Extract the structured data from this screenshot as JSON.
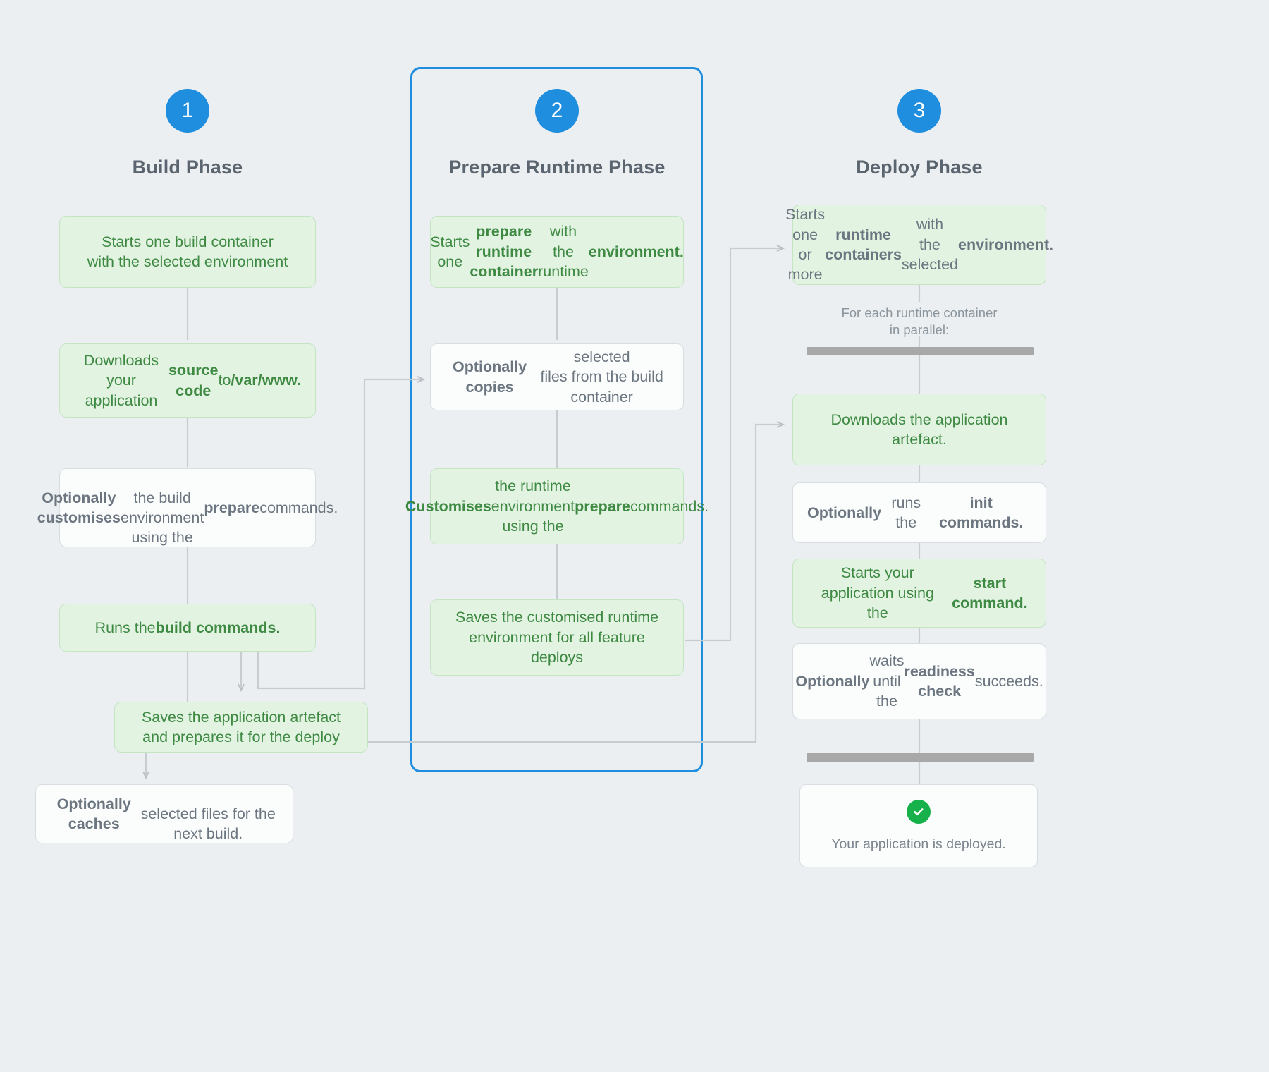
{
  "diagram": {
    "type": "flowchart",
    "background_color": "#eceff1",
    "accent_color": "#1f8ede",
    "green_box_bg": "#e2f3e2",
    "green_text_color": "#3f8a43",
    "gray_text_color": "#6b7680",
    "success_color": "#16b14b",
    "highlighted_phase": "Prepare Runtime Phase"
  },
  "columns": [
    {
      "number": "1",
      "title": "Build Phase",
      "steps": [
        {
          "id": "b1",
          "style": "green",
          "html": "Starts one build container<br>with the selected environment"
        },
        {
          "id": "b2",
          "style": "green",
          "html": "Downloads your application<br><b>source code</b> to <b>/var/www.</b>"
        },
        {
          "id": "b3",
          "style": "white",
          "html": "<b>Optionally customises</b><br>the build environment<br>using the <b>prepare</b> commands."
        },
        {
          "id": "b4",
          "style": "green",
          "html": "Runs the <b>build commands.</b>"
        },
        {
          "id": "b5",
          "style": "green",
          "html": "Saves the application artefact<br>and prepares it for the deploy"
        },
        {
          "id": "b6",
          "style": "white",
          "html": "<b>Optionally caches</b><br>selected files for the next build."
        }
      ]
    },
    {
      "number": "2",
      "title": "Prepare Runtime Phase",
      "steps": [
        {
          "id": "p1",
          "style": "green",
          "html": "Starts one <b>prepare runtime<br>container</b> with the runtime<br><b>environment.</b>"
        },
        {
          "id": "p2",
          "style": "white",
          "html": "<b>Optionally copies</b> selected<br>files from the build container"
        },
        {
          "id": "p3",
          "style": "green",
          "html": "<b>Customises</b> the runtime<br>environment using the<br><b>prepare</b> commands."
        },
        {
          "id": "p4",
          "style": "green",
          "html": "Saves the customised runtime<br>environment for all feature<br>deploys"
        }
      ]
    },
    {
      "number": "3",
      "title": "Deploy Phase",
      "steps": [
        {
          "id": "d1",
          "style": "green-gray",
          "html": "Starts one or more<br><b>runtime containers</b> with<br>the selected <b>environment.</b>"
        },
        {
          "id": "d2",
          "style": "green",
          "html": "Downloads the application<br>artefact."
        },
        {
          "id": "d3",
          "style": "white",
          "html": "<b>Optionally</b> runs the<br><b>init commands.</b>"
        },
        {
          "id": "d4",
          "style": "green",
          "html": "Starts your application using<br>the <b>start command.</b>"
        },
        {
          "id": "d5",
          "style": "white",
          "html": "<b>Optionally</b> waits until the<br><b>readiness check</b> succeeds."
        }
      ],
      "parallel_label": "For each runtime container\nin parallel:",
      "parallel_label_line1": "For each runtime container",
      "parallel_label_line2": "in parallel:",
      "deployed_message": "Your application is deployed.",
      "deployed_icon": "check-circle-icon"
    }
  ]
}
